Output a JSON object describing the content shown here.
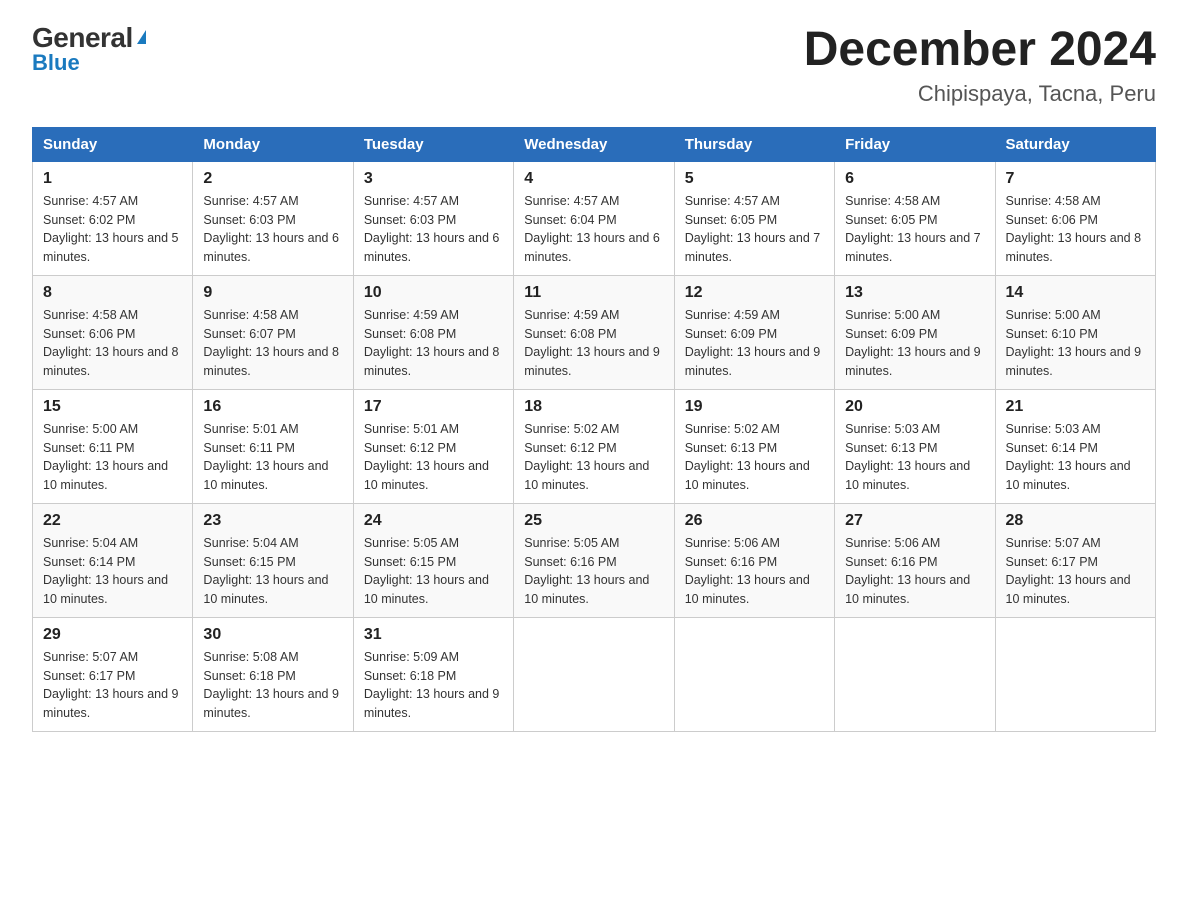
{
  "header": {
    "logo_general": "General",
    "logo_arrow": "▶",
    "logo_blue": "Blue",
    "month_title": "December 2024",
    "location": "Chipispaya, Tacna, Peru"
  },
  "days_of_week": [
    "Sunday",
    "Monday",
    "Tuesday",
    "Wednesday",
    "Thursday",
    "Friday",
    "Saturday"
  ],
  "weeks": [
    [
      {
        "day": "1",
        "sunrise": "4:57 AM",
        "sunset": "6:02 PM",
        "daylight": "13 hours and 5 minutes."
      },
      {
        "day": "2",
        "sunrise": "4:57 AM",
        "sunset": "6:03 PM",
        "daylight": "13 hours and 6 minutes."
      },
      {
        "day": "3",
        "sunrise": "4:57 AM",
        "sunset": "6:03 PM",
        "daylight": "13 hours and 6 minutes."
      },
      {
        "day": "4",
        "sunrise": "4:57 AM",
        "sunset": "6:04 PM",
        "daylight": "13 hours and 6 minutes."
      },
      {
        "day": "5",
        "sunrise": "4:57 AM",
        "sunset": "6:05 PM",
        "daylight": "13 hours and 7 minutes."
      },
      {
        "day": "6",
        "sunrise": "4:58 AM",
        "sunset": "6:05 PM",
        "daylight": "13 hours and 7 minutes."
      },
      {
        "day": "7",
        "sunrise": "4:58 AM",
        "sunset": "6:06 PM",
        "daylight": "13 hours and 8 minutes."
      }
    ],
    [
      {
        "day": "8",
        "sunrise": "4:58 AM",
        "sunset": "6:06 PM",
        "daylight": "13 hours and 8 minutes."
      },
      {
        "day": "9",
        "sunrise": "4:58 AM",
        "sunset": "6:07 PM",
        "daylight": "13 hours and 8 minutes."
      },
      {
        "day": "10",
        "sunrise": "4:59 AM",
        "sunset": "6:08 PM",
        "daylight": "13 hours and 8 minutes."
      },
      {
        "day": "11",
        "sunrise": "4:59 AM",
        "sunset": "6:08 PM",
        "daylight": "13 hours and 9 minutes."
      },
      {
        "day": "12",
        "sunrise": "4:59 AM",
        "sunset": "6:09 PM",
        "daylight": "13 hours and 9 minutes."
      },
      {
        "day": "13",
        "sunrise": "5:00 AM",
        "sunset": "6:09 PM",
        "daylight": "13 hours and 9 minutes."
      },
      {
        "day": "14",
        "sunrise": "5:00 AM",
        "sunset": "6:10 PM",
        "daylight": "13 hours and 9 minutes."
      }
    ],
    [
      {
        "day": "15",
        "sunrise": "5:00 AM",
        "sunset": "6:11 PM",
        "daylight": "13 hours and 10 minutes."
      },
      {
        "day": "16",
        "sunrise": "5:01 AM",
        "sunset": "6:11 PM",
        "daylight": "13 hours and 10 minutes."
      },
      {
        "day": "17",
        "sunrise": "5:01 AM",
        "sunset": "6:12 PM",
        "daylight": "13 hours and 10 minutes."
      },
      {
        "day": "18",
        "sunrise": "5:02 AM",
        "sunset": "6:12 PM",
        "daylight": "13 hours and 10 minutes."
      },
      {
        "day": "19",
        "sunrise": "5:02 AM",
        "sunset": "6:13 PM",
        "daylight": "13 hours and 10 minutes."
      },
      {
        "day": "20",
        "sunrise": "5:03 AM",
        "sunset": "6:13 PM",
        "daylight": "13 hours and 10 minutes."
      },
      {
        "day": "21",
        "sunrise": "5:03 AM",
        "sunset": "6:14 PM",
        "daylight": "13 hours and 10 minutes."
      }
    ],
    [
      {
        "day": "22",
        "sunrise": "5:04 AM",
        "sunset": "6:14 PM",
        "daylight": "13 hours and 10 minutes."
      },
      {
        "day": "23",
        "sunrise": "5:04 AM",
        "sunset": "6:15 PM",
        "daylight": "13 hours and 10 minutes."
      },
      {
        "day": "24",
        "sunrise": "5:05 AM",
        "sunset": "6:15 PM",
        "daylight": "13 hours and 10 minutes."
      },
      {
        "day": "25",
        "sunrise": "5:05 AM",
        "sunset": "6:16 PM",
        "daylight": "13 hours and 10 minutes."
      },
      {
        "day": "26",
        "sunrise": "5:06 AM",
        "sunset": "6:16 PM",
        "daylight": "13 hours and 10 minutes."
      },
      {
        "day": "27",
        "sunrise": "5:06 AM",
        "sunset": "6:16 PM",
        "daylight": "13 hours and 10 minutes."
      },
      {
        "day": "28",
        "sunrise": "5:07 AM",
        "sunset": "6:17 PM",
        "daylight": "13 hours and 10 minutes."
      }
    ],
    [
      {
        "day": "29",
        "sunrise": "5:07 AM",
        "sunset": "6:17 PM",
        "daylight": "13 hours and 9 minutes."
      },
      {
        "day": "30",
        "sunrise": "5:08 AM",
        "sunset": "6:18 PM",
        "daylight": "13 hours and 9 minutes."
      },
      {
        "day": "31",
        "sunrise": "5:09 AM",
        "sunset": "6:18 PM",
        "daylight": "13 hours and 9 minutes."
      },
      null,
      null,
      null,
      null
    ]
  ]
}
